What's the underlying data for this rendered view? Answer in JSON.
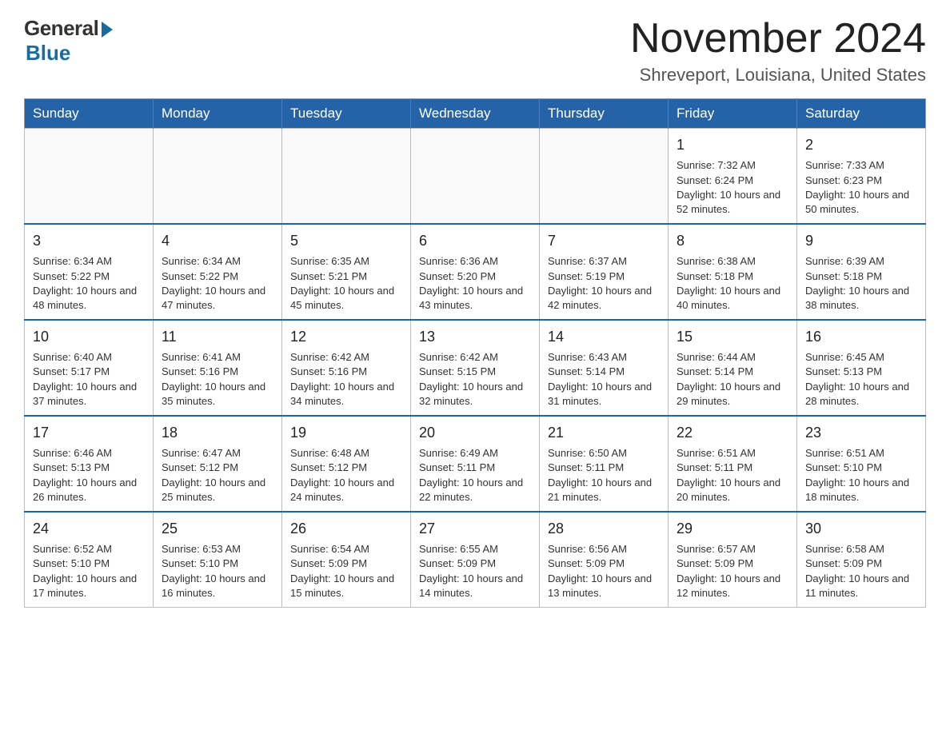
{
  "logo": {
    "general": "General",
    "blue": "Blue"
  },
  "title": "November 2024",
  "location": "Shreveport, Louisiana, United States",
  "weekdays": [
    "Sunday",
    "Monday",
    "Tuesday",
    "Wednesday",
    "Thursday",
    "Friday",
    "Saturday"
  ],
  "weeks": [
    [
      {
        "day": "",
        "sunrise": "",
        "sunset": "",
        "daylight": ""
      },
      {
        "day": "",
        "sunrise": "",
        "sunset": "",
        "daylight": ""
      },
      {
        "day": "",
        "sunrise": "",
        "sunset": "",
        "daylight": ""
      },
      {
        "day": "",
        "sunrise": "",
        "sunset": "",
        "daylight": ""
      },
      {
        "day": "",
        "sunrise": "",
        "sunset": "",
        "daylight": ""
      },
      {
        "day": "1",
        "sunrise": "Sunrise: 7:32 AM",
        "sunset": "Sunset: 6:24 PM",
        "daylight": "Daylight: 10 hours and 52 minutes."
      },
      {
        "day": "2",
        "sunrise": "Sunrise: 7:33 AM",
        "sunset": "Sunset: 6:23 PM",
        "daylight": "Daylight: 10 hours and 50 minutes."
      }
    ],
    [
      {
        "day": "3",
        "sunrise": "Sunrise: 6:34 AM",
        "sunset": "Sunset: 5:22 PM",
        "daylight": "Daylight: 10 hours and 48 minutes."
      },
      {
        "day": "4",
        "sunrise": "Sunrise: 6:34 AM",
        "sunset": "Sunset: 5:22 PM",
        "daylight": "Daylight: 10 hours and 47 minutes."
      },
      {
        "day": "5",
        "sunrise": "Sunrise: 6:35 AM",
        "sunset": "Sunset: 5:21 PM",
        "daylight": "Daylight: 10 hours and 45 minutes."
      },
      {
        "day": "6",
        "sunrise": "Sunrise: 6:36 AM",
        "sunset": "Sunset: 5:20 PM",
        "daylight": "Daylight: 10 hours and 43 minutes."
      },
      {
        "day": "7",
        "sunrise": "Sunrise: 6:37 AM",
        "sunset": "Sunset: 5:19 PM",
        "daylight": "Daylight: 10 hours and 42 minutes."
      },
      {
        "day": "8",
        "sunrise": "Sunrise: 6:38 AM",
        "sunset": "Sunset: 5:18 PM",
        "daylight": "Daylight: 10 hours and 40 minutes."
      },
      {
        "day": "9",
        "sunrise": "Sunrise: 6:39 AM",
        "sunset": "Sunset: 5:18 PM",
        "daylight": "Daylight: 10 hours and 38 minutes."
      }
    ],
    [
      {
        "day": "10",
        "sunrise": "Sunrise: 6:40 AM",
        "sunset": "Sunset: 5:17 PM",
        "daylight": "Daylight: 10 hours and 37 minutes."
      },
      {
        "day": "11",
        "sunrise": "Sunrise: 6:41 AM",
        "sunset": "Sunset: 5:16 PM",
        "daylight": "Daylight: 10 hours and 35 minutes."
      },
      {
        "day": "12",
        "sunrise": "Sunrise: 6:42 AM",
        "sunset": "Sunset: 5:16 PM",
        "daylight": "Daylight: 10 hours and 34 minutes."
      },
      {
        "day": "13",
        "sunrise": "Sunrise: 6:42 AM",
        "sunset": "Sunset: 5:15 PM",
        "daylight": "Daylight: 10 hours and 32 minutes."
      },
      {
        "day": "14",
        "sunrise": "Sunrise: 6:43 AM",
        "sunset": "Sunset: 5:14 PM",
        "daylight": "Daylight: 10 hours and 31 minutes."
      },
      {
        "day": "15",
        "sunrise": "Sunrise: 6:44 AM",
        "sunset": "Sunset: 5:14 PM",
        "daylight": "Daylight: 10 hours and 29 minutes."
      },
      {
        "day": "16",
        "sunrise": "Sunrise: 6:45 AM",
        "sunset": "Sunset: 5:13 PM",
        "daylight": "Daylight: 10 hours and 28 minutes."
      }
    ],
    [
      {
        "day": "17",
        "sunrise": "Sunrise: 6:46 AM",
        "sunset": "Sunset: 5:13 PM",
        "daylight": "Daylight: 10 hours and 26 minutes."
      },
      {
        "day": "18",
        "sunrise": "Sunrise: 6:47 AM",
        "sunset": "Sunset: 5:12 PM",
        "daylight": "Daylight: 10 hours and 25 minutes."
      },
      {
        "day": "19",
        "sunrise": "Sunrise: 6:48 AM",
        "sunset": "Sunset: 5:12 PM",
        "daylight": "Daylight: 10 hours and 24 minutes."
      },
      {
        "day": "20",
        "sunrise": "Sunrise: 6:49 AM",
        "sunset": "Sunset: 5:11 PM",
        "daylight": "Daylight: 10 hours and 22 minutes."
      },
      {
        "day": "21",
        "sunrise": "Sunrise: 6:50 AM",
        "sunset": "Sunset: 5:11 PM",
        "daylight": "Daylight: 10 hours and 21 minutes."
      },
      {
        "day": "22",
        "sunrise": "Sunrise: 6:51 AM",
        "sunset": "Sunset: 5:11 PM",
        "daylight": "Daylight: 10 hours and 20 minutes."
      },
      {
        "day": "23",
        "sunrise": "Sunrise: 6:51 AM",
        "sunset": "Sunset: 5:10 PM",
        "daylight": "Daylight: 10 hours and 18 minutes."
      }
    ],
    [
      {
        "day": "24",
        "sunrise": "Sunrise: 6:52 AM",
        "sunset": "Sunset: 5:10 PM",
        "daylight": "Daylight: 10 hours and 17 minutes."
      },
      {
        "day": "25",
        "sunrise": "Sunrise: 6:53 AM",
        "sunset": "Sunset: 5:10 PM",
        "daylight": "Daylight: 10 hours and 16 minutes."
      },
      {
        "day": "26",
        "sunrise": "Sunrise: 6:54 AM",
        "sunset": "Sunset: 5:09 PM",
        "daylight": "Daylight: 10 hours and 15 minutes."
      },
      {
        "day": "27",
        "sunrise": "Sunrise: 6:55 AM",
        "sunset": "Sunset: 5:09 PM",
        "daylight": "Daylight: 10 hours and 14 minutes."
      },
      {
        "day": "28",
        "sunrise": "Sunrise: 6:56 AM",
        "sunset": "Sunset: 5:09 PM",
        "daylight": "Daylight: 10 hours and 13 minutes."
      },
      {
        "day": "29",
        "sunrise": "Sunrise: 6:57 AM",
        "sunset": "Sunset: 5:09 PM",
        "daylight": "Daylight: 10 hours and 12 minutes."
      },
      {
        "day": "30",
        "sunrise": "Sunrise: 6:58 AM",
        "sunset": "Sunset: 5:09 PM",
        "daylight": "Daylight: 10 hours and 11 minutes."
      }
    ]
  ]
}
